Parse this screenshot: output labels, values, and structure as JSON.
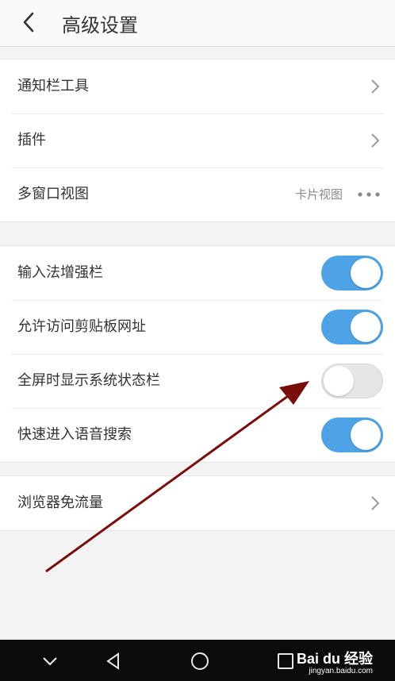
{
  "header": {
    "title": "高级设置",
    "back_icon": "chevron-left-icon"
  },
  "group1": [
    {
      "label": "通知栏工具"
    },
    {
      "label": "插件"
    },
    {
      "label": "多窗口视图",
      "value": "卡片视图"
    }
  ],
  "group2": [
    {
      "label": "输入法增强栏",
      "on": true
    },
    {
      "label": "允许访问剪贴板网址",
      "on": true
    },
    {
      "label": "全屏时显示系统状态栏",
      "on": false
    },
    {
      "label": "快速进入语音搜索",
      "on": true
    }
  ],
  "group3": [
    {
      "label": "浏览器免流量"
    }
  ],
  "colors": {
    "toggle_on": "#4da3e6",
    "toggle_off": "#e6e6e6",
    "annotation_arrow": "#7a0c0c"
  },
  "navbar": {
    "icons": [
      "chevron-down-icon",
      "back-triangle-icon",
      "home-circle-icon",
      "recents-square-icon"
    ]
  },
  "watermark": {
    "brand": "Bai du 经验",
    "url": "jingyan.baidu.com"
  }
}
